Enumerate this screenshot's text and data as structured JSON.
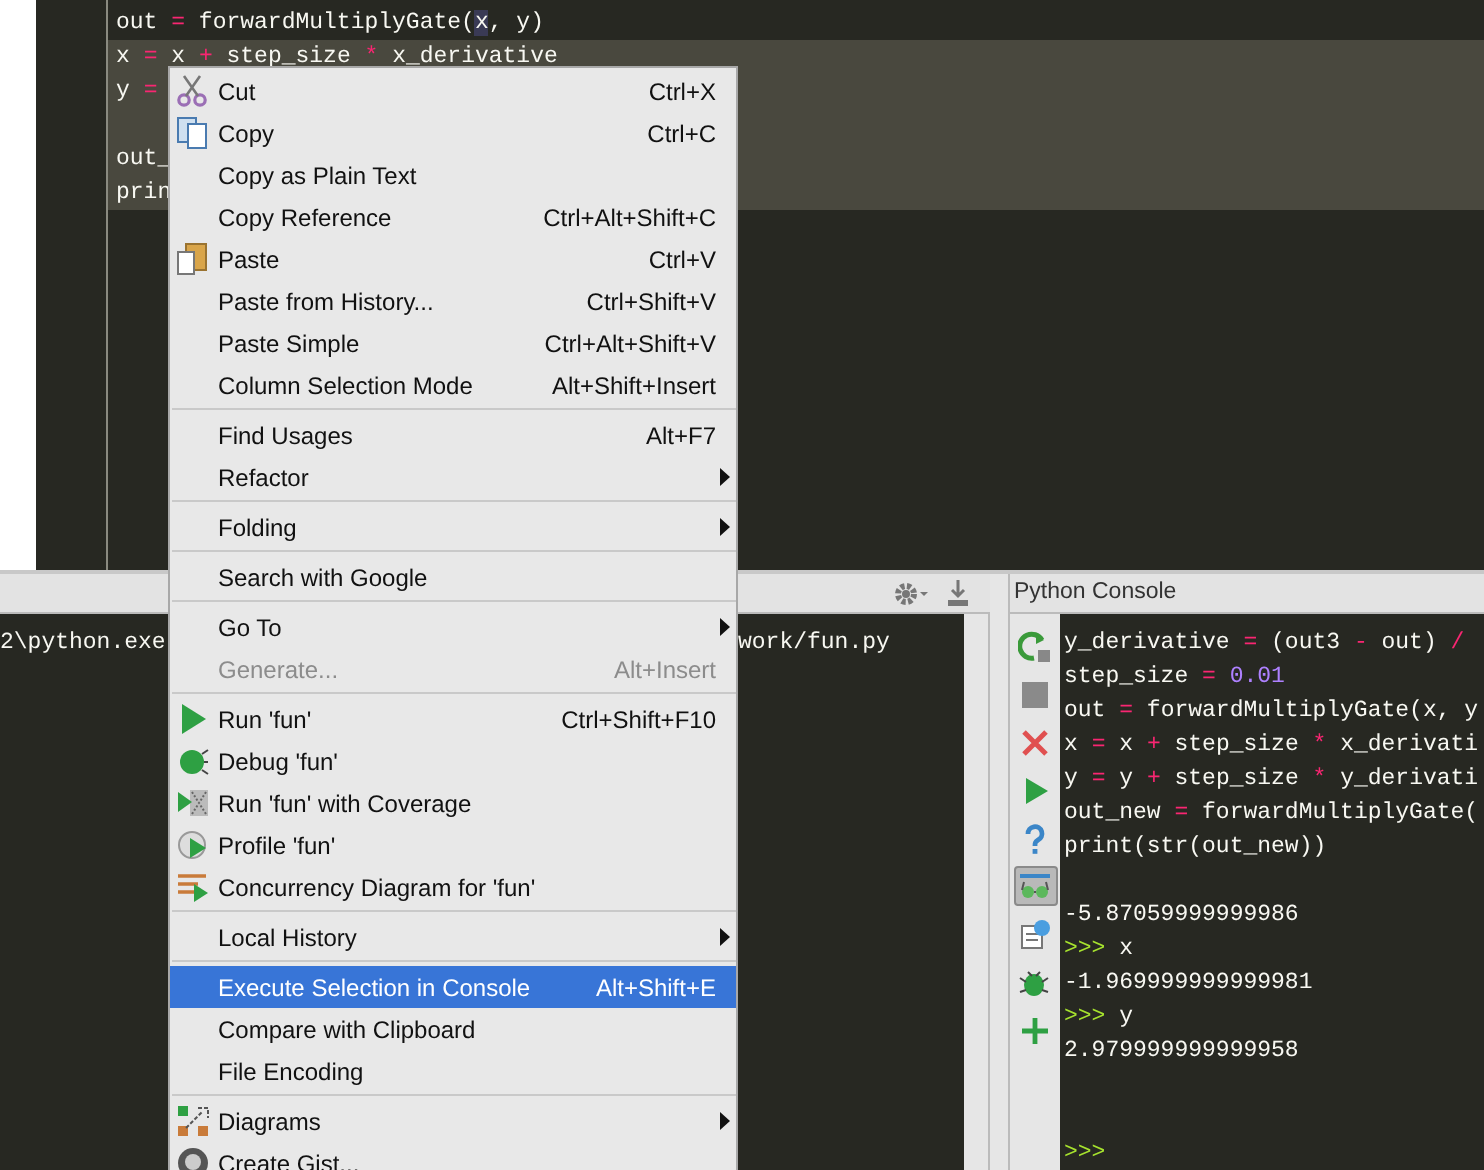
{
  "editor": {
    "lines": [
      {
        "selected": false,
        "tokens": [
          {
            "kind": "id",
            "t": "out "
          },
          {
            "kind": "op",
            "t": "="
          },
          {
            "kind": "id",
            "t": " forwardMultiplyGate("
          },
          {
            "kind": "caret",
            "t": "x"
          },
          {
            "kind": "id",
            "t": ", y)"
          }
        ]
      },
      {
        "selected": true,
        "tokens": [
          {
            "kind": "id",
            "t": "x "
          },
          {
            "kind": "op",
            "t": "="
          },
          {
            "kind": "id",
            "t": " x "
          },
          {
            "kind": "op",
            "t": "+"
          },
          {
            "kind": "id",
            "t": " step_size "
          },
          {
            "kind": "op",
            "t": "*"
          },
          {
            "kind": "id",
            "t": " x_derivative"
          }
        ]
      },
      {
        "selected": true,
        "tokens": [
          {
            "kind": "id",
            "t": "y "
          },
          {
            "kind": "op",
            "t": "="
          }
        ]
      },
      {
        "selected": true
      },
      {
        "selected": true,
        "tokens": [
          {
            "kind": "id",
            "t": "out_"
          }
        ]
      },
      {
        "selected": true,
        "tokens": [
          {
            "kind": "id",
            "t": "prin"
          }
        ]
      }
    ]
  },
  "context_menu": [
    {
      "kind": "item",
      "label": "Cut",
      "shortcut": "Ctrl+X",
      "submenu": false,
      "disabled": false,
      "selected": false
    },
    {
      "kind": "item",
      "label": "Copy",
      "shortcut": "Ctrl+C",
      "submenu": false,
      "disabled": false,
      "selected": false
    },
    {
      "kind": "item",
      "label": "Copy as Plain Text",
      "submenu": false,
      "disabled": false,
      "selected": false
    },
    {
      "kind": "item",
      "label": "Copy Reference",
      "shortcut": "Ctrl+Alt+Shift+C",
      "submenu": false,
      "disabled": false,
      "selected": false
    },
    {
      "kind": "item",
      "label": "Paste",
      "shortcut": "Ctrl+V",
      "submenu": false,
      "disabled": false,
      "selected": false
    },
    {
      "kind": "item",
      "label": "Paste from History...",
      "shortcut": "Ctrl+Shift+V",
      "submenu": false,
      "disabled": false,
      "selected": false
    },
    {
      "kind": "item",
      "label": "Paste Simple",
      "shortcut": "Ctrl+Alt+Shift+V",
      "submenu": false,
      "disabled": false,
      "selected": false
    },
    {
      "kind": "item",
      "label": "Column Selection Mode",
      "shortcut": "Alt+Shift+Insert",
      "submenu": false,
      "disabled": false,
      "selected": false
    },
    {
      "kind": "separator"
    },
    {
      "kind": "item",
      "label": "Find Usages",
      "shortcut": "Alt+F7",
      "submenu": false,
      "disabled": false,
      "selected": false
    },
    {
      "kind": "item",
      "label": "Refactor",
      "submenu": true,
      "disabled": false,
      "selected": false
    },
    {
      "kind": "separator"
    },
    {
      "kind": "item",
      "label": "Folding",
      "submenu": true,
      "disabled": false,
      "selected": false
    },
    {
      "kind": "separator"
    },
    {
      "kind": "item",
      "label": "Search with Google",
      "submenu": false,
      "disabled": false,
      "selected": false
    },
    {
      "kind": "separator"
    },
    {
      "kind": "item",
      "label": "Go To",
      "submenu": true,
      "disabled": false,
      "selected": false
    },
    {
      "kind": "item",
      "label": "Generate...",
      "shortcut": "Alt+Insert",
      "submenu": false,
      "disabled": true,
      "selected": false
    },
    {
      "kind": "separator"
    },
    {
      "kind": "item",
      "label": "Run 'fun'",
      "shortcut": "Ctrl+Shift+F10",
      "submenu": false,
      "disabled": false,
      "selected": false
    },
    {
      "kind": "item",
      "label": "Debug 'fun'",
      "submenu": false,
      "disabled": false,
      "selected": false
    },
    {
      "kind": "item",
      "label": "Run 'fun' with Coverage",
      "submenu": false,
      "disabled": false,
      "selected": false
    },
    {
      "kind": "item",
      "label": "Profile 'fun'",
      "submenu": false,
      "disabled": false,
      "selected": false
    },
    {
      "kind": "item",
      "label": "Concurrency Diagram for  'fun'",
      "submenu": false,
      "disabled": false,
      "selected": false
    },
    {
      "kind": "separator"
    },
    {
      "kind": "item",
      "label": "Local History",
      "submenu": true,
      "disabled": false,
      "selected": false
    },
    {
      "kind": "separator"
    },
    {
      "kind": "item",
      "label": "Execute Selection in Console",
      "shortcut": "Alt+Shift+E",
      "submenu": false,
      "disabled": false,
      "selected": true
    },
    {
      "kind": "item",
      "label": "Compare with Clipboard",
      "submenu": false,
      "disabled": false,
      "selected": false
    },
    {
      "kind": "item",
      "label": "File Encoding",
      "submenu": false,
      "disabled": false,
      "selected": false
    },
    {
      "kind": "separator"
    },
    {
      "kind": "item",
      "label": "Diagrams",
      "submenu": true,
      "disabled": false,
      "selected": false
    },
    {
      "kind": "item",
      "label": "Create Gist..."
    }
  ],
  "run_panel": {
    "output_left": "2\\python.exe",
    "output_right": "work/fun.py"
  },
  "python_console": {
    "title": "Python Console",
    "tools": [
      {
        "selected": false
      },
      {
        "selected": false
      },
      {
        "selected": false
      },
      {
        "selected": false
      },
      {
        "selected": false
      },
      {
        "selected": true
      },
      {
        "selected": false
      },
      {
        "selected": false
      },
      {
        "selected": false
      }
    ],
    "lines": [
      {
        "tokens": [
          {
            "kind": "id",
            "t": "y_derivative "
          },
          {
            "kind": "op",
            "t": "="
          },
          {
            "kind": "id",
            "t": " (out3 "
          },
          {
            "kind": "op",
            "t": "-"
          },
          {
            "kind": "id",
            "t": " out) "
          },
          {
            "kind": "op",
            "t": "/"
          }
        ]
      },
      {
        "tokens": [
          {
            "kind": "id",
            "t": "step_size "
          },
          {
            "kind": "op",
            "t": "= "
          },
          {
            "kind": "num",
            "t": "0.01"
          }
        ]
      },
      {
        "tokens": [
          {
            "kind": "id",
            "t": "out "
          },
          {
            "kind": "op",
            "t": "="
          },
          {
            "kind": "id",
            "t": " forwardMultiplyGate(x, y"
          }
        ]
      },
      {
        "tokens": [
          {
            "kind": "id",
            "t": "x "
          },
          {
            "kind": "op",
            "t": "="
          },
          {
            "kind": "id",
            "t": " x "
          },
          {
            "kind": "op",
            "t": "+"
          },
          {
            "kind": "id",
            "t": " step_size "
          },
          {
            "kind": "op",
            "t": "*"
          },
          {
            "kind": "id",
            "t": " x_derivati"
          }
        ]
      },
      {
        "tokens": [
          {
            "kind": "id",
            "t": "y "
          },
          {
            "kind": "op",
            "t": "="
          },
          {
            "kind": "id",
            "t": " y "
          },
          {
            "kind": "op",
            "t": "+"
          },
          {
            "kind": "id",
            "t": " step_size "
          },
          {
            "kind": "op",
            "t": "*"
          },
          {
            "kind": "id",
            "t": " y_derivati"
          }
        ]
      },
      {
        "tokens": [
          {
            "kind": "id",
            "t": "out_new "
          },
          {
            "kind": "op",
            "t": "="
          },
          {
            "kind": "id",
            "t": " forwardMultiplyGate("
          }
        ]
      },
      {
        "tokens": [
          {
            "kind": "id",
            "t": "print(str(out_new))"
          }
        ]
      },
      {
        "kind": "blank"
      },
      {
        "tokens": [
          {
            "kind": "id",
            "t": "-5.87059999999986"
          }
        ]
      },
      {
        "tokens": [
          {
            "kind": "prompt",
            "t": ">>>"
          },
          {
            "kind": "id",
            "t": " x"
          }
        ]
      },
      {
        "tokens": [
          {
            "kind": "id",
            "t": "-1.969999999999981"
          }
        ]
      },
      {
        "tokens": [
          {
            "kind": "prompt",
            "t": ">>>"
          },
          {
            "kind": "id",
            "t": " y"
          }
        ]
      },
      {
        "tokens": [
          {
            "kind": "id",
            "t": "2.979999999999958"
          }
        ]
      },
      {
        "kind": "blank"
      },
      {
        "kind": "blank"
      },
      {
        "tokens": [
          {
            "kind": "prompt",
            "t": ">>>"
          }
        ]
      }
    ]
  }
}
